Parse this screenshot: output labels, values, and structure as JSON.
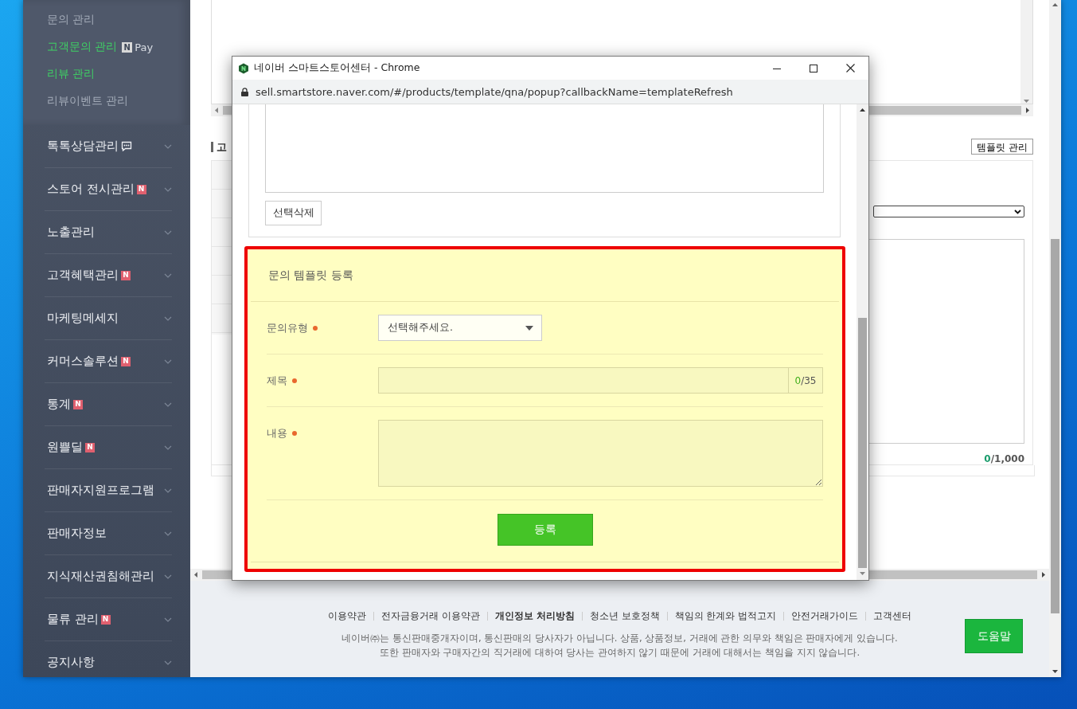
{
  "sidebar": {
    "sub_items": [
      {
        "label": "문의 관리",
        "highlighted": false
      },
      {
        "label": "고객문의 관리",
        "highlighted": true,
        "npay": {
          "mark": "N",
          "text": "Pay"
        }
      },
      {
        "label": "리뷰 관리",
        "highlighted": true
      },
      {
        "label": "리뷰이벤트 관리",
        "highlighted": false
      }
    ],
    "menu_items": [
      {
        "label": "톡톡상담관리",
        "kind": "chat"
      },
      {
        "label": "스토어 전시관리",
        "kind": "new",
        "badge": "N"
      },
      {
        "label": "노출관리",
        "kind": "plain"
      },
      {
        "label": "고객혜택관리",
        "kind": "new",
        "badge": "N"
      },
      {
        "label": "마케팅메세지",
        "kind": "plain"
      },
      {
        "label": "커머스솔루션",
        "kind": "new",
        "badge": "N"
      },
      {
        "label": "통계",
        "kind": "new",
        "badge": "N"
      },
      {
        "label": "원쁠딜",
        "kind": "new",
        "badge": "N"
      },
      {
        "label": "판매자지원프로그램",
        "kind": "plain"
      },
      {
        "label": "판매자정보",
        "kind": "plain"
      },
      {
        "label": "지식재산권침해관리",
        "kind": "plain"
      },
      {
        "label": "물류 관리",
        "kind": "new",
        "badge": "N"
      },
      {
        "label": "공지사항",
        "kind": "plain"
      }
    ]
  },
  "background_page": {
    "section_title": "고",
    "template_button": "템플릿 관리",
    "counter": {
      "current": "0",
      "max": "/1,000"
    }
  },
  "footer": {
    "links": [
      {
        "label": "이용약관",
        "emphasized": false
      },
      {
        "label": "전자금융거래 이용약관",
        "emphasized": false
      },
      {
        "label": "개인정보 처리방침",
        "emphasized": true
      },
      {
        "label": "청소년 보호정책",
        "emphasized": false
      },
      {
        "label": "책임의 한계와 법적고지",
        "emphasized": false
      },
      {
        "label": "안전거래가이드",
        "emphasized": false
      },
      {
        "label": "고객센터",
        "emphasized": false
      }
    ],
    "notice": [
      "네이버㈜는 통신판매중개자이며, 통신판매의 당사자가 아닙니다. 상품, 상품정보, 거래에 관한 의무와 책임은 판매자에게 있습니다.",
      "또한 판매자와 구매자간의 직거래에 대하여 당사는 관여하지 않기 때문에 거래에 대해서는 책임을 지지 않습니다."
    ],
    "help_button": "도움말"
  },
  "popup": {
    "window": {
      "title": "네이버 스마트스토어센터 - Chrome",
      "url": "sell.smartstore.naver.com/#/products/template/qna/popup?callbackName=templateRefresh"
    },
    "delete_button": "선택삭제",
    "form": {
      "title": "문의 템플릿 등록",
      "highlighted": true,
      "fields": [
        {
          "kind": "select",
          "label": "문의유형",
          "required": true,
          "value": "선택해주세요."
        },
        {
          "kind": "text",
          "label": "제목",
          "required": true,
          "counter": {
            "current": "0",
            "max": "/35"
          }
        },
        {
          "kind": "textarea",
          "label": "내용",
          "required": true
        }
      ],
      "submit_button": "등록"
    }
  }
}
